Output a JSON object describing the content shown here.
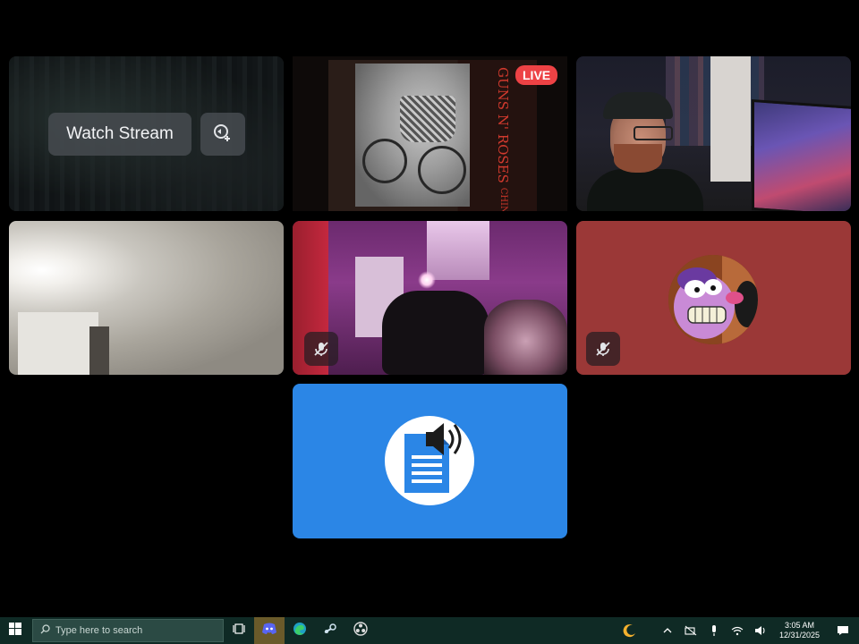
{
  "stage": {
    "stream_tile": {
      "watch_label": "Watch Stream"
    },
    "album_tile": {
      "live_label": "LIVE",
      "album_band": "GUNS N' ROSES",
      "album_title": "CHINESE DEMOCRACY"
    }
  },
  "taskbar": {
    "search_placeholder": "Type here to search",
    "clock_time": "3:05 AM",
    "clock_date": "12/31/2025",
    "pinned_icons": [
      "task-view-icon",
      "discord-icon",
      "edge-icon",
      "steam-icon",
      "obs-icon"
    ],
    "tray_icons": [
      "moon-icon",
      "chevron-up-icon",
      "network-off-icon",
      "microphone-icon",
      "wifi-icon",
      "volume-icon",
      "notification-icon"
    ]
  },
  "colors": {
    "live_red": "#ed4245",
    "tts_blue": "#2b86e6",
    "avatar_tile_red": "#9b3837",
    "taskbar_bg": "#0f2a25"
  }
}
